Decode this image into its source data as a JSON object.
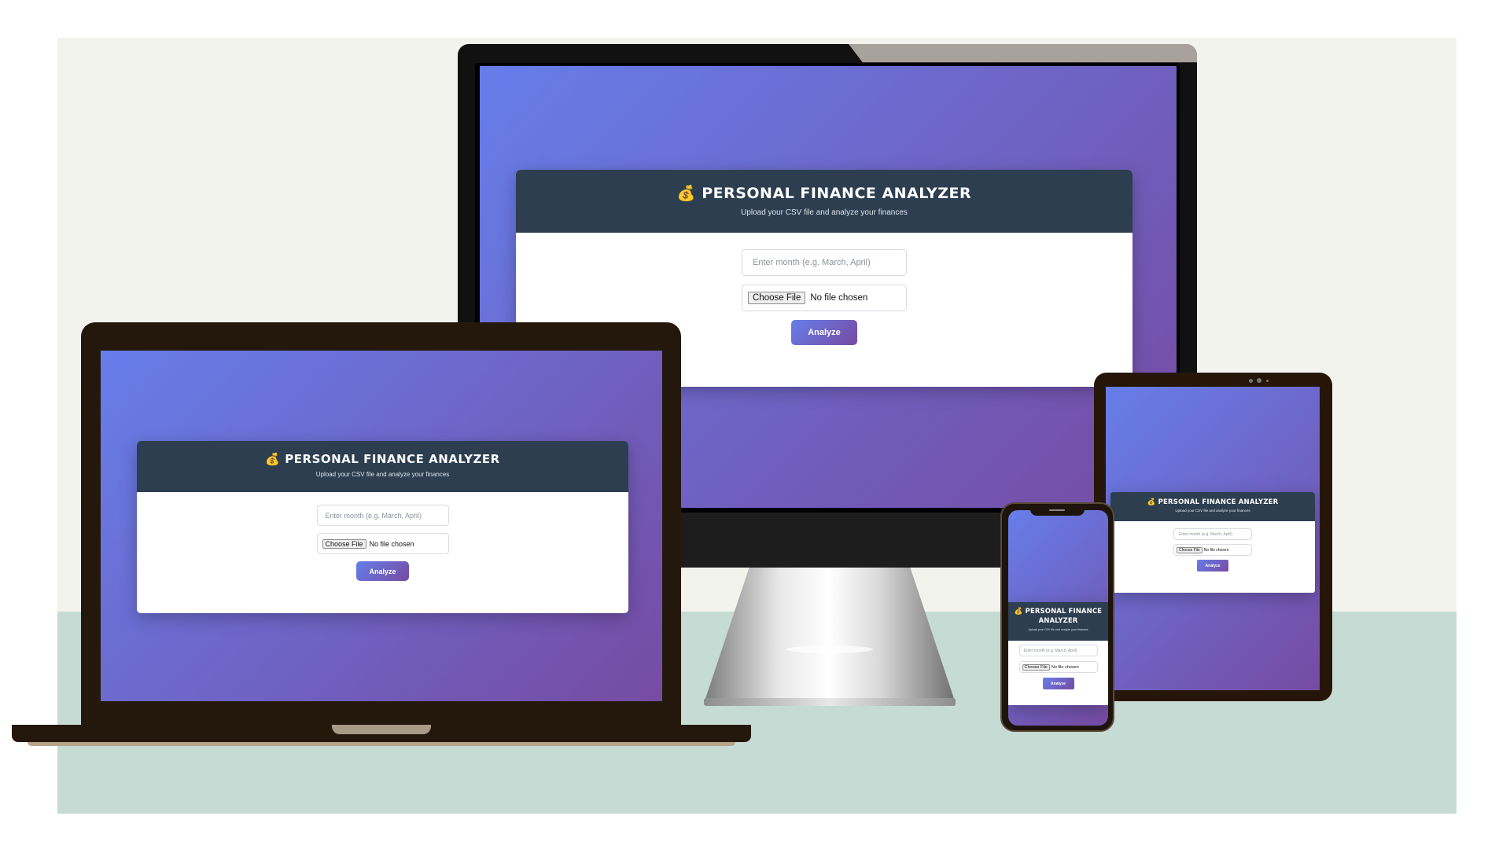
{
  "app": {
    "title": "PERSONAL FINANCE ANALYZER",
    "subtitle": "Upload your CSV file and analyze your finances",
    "month_placeholder": "Enter month (e.g. March, April)",
    "choose_file_label": "Choose File",
    "no_file_text": "No file chosen",
    "analyze_label": "Analyze",
    "bag_icon": "💰"
  },
  "phone": {
    "title_line1": "PERSONAL FINANCE",
    "title_line2": "ANALYZER"
  },
  "colors": {
    "gradient_start": "#667eea",
    "gradient_end": "#764ba2",
    "header_bg": "#2c3e50",
    "background": "#f3f3ee",
    "floor": "#c6dbd3"
  }
}
